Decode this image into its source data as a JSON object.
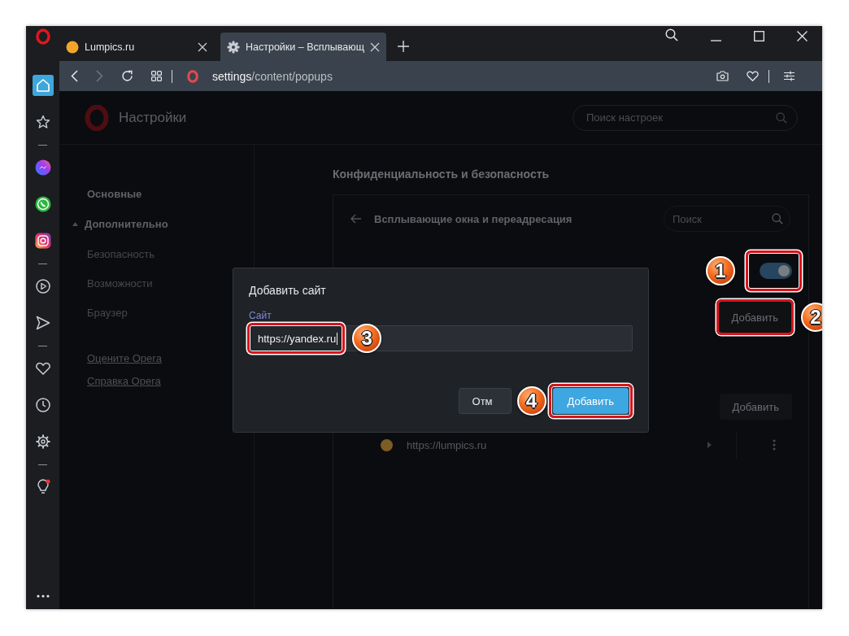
{
  "browser": {
    "tabs": [
      {
        "title": "Lumpics.ru",
        "kind": "site",
        "selected": false
      },
      {
        "title": "Настройки – Всплывающ",
        "kind": "settings",
        "selected": true
      }
    ],
    "address": {
      "host": "settings",
      "path": "/content/popups"
    }
  },
  "sidebar": {
    "groups": [
      [
        {
          "kind": "home",
          "selected": true
        },
        {
          "kind": "star",
          "selected": false
        }
      ],
      [
        {
          "kind": "messenger",
          "selected": false
        },
        {
          "kind": "whatsapp",
          "selected": false
        },
        {
          "kind": "instagram",
          "selected": false
        }
      ],
      [
        {
          "kind": "player",
          "selected": false
        },
        {
          "kind": "send",
          "selected": false
        }
      ],
      [
        {
          "kind": "heart",
          "selected": false
        },
        {
          "kind": "clock",
          "selected": false
        },
        {
          "kind": "gear",
          "selected": false
        }
      ],
      [
        {
          "kind": "bulb",
          "selected": false
        }
      ]
    ]
  },
  "settings": {
    "title": "Настройки",
    "search_placeholder": "Поиск настроек",
    "nav": {
      "main": "Основные",
      "advanced": {
        "label": "Дополнительно",
        "expanded": true,
        "children": [
          "Безопасность",
          "Возможности",
          "Браузер"
        ]
      },
      "links": [
        "Оцените Opera",
        "Справка Opera"
      ]
    },
    "section_title": "Конфиденциальность и безопасность",
    "panel": {
      "title": "Всплывающие окна и переадресация",
      "search_placeholder": "Поиск",
      "toggle": {
        "on": true,
        "callout": "1"
      },
      "add_buttons": [
        {
          "label": "Добавить",
          "callout": "2"
        },
        {
          "label": "Добавить"
        }
      ],
      "sites": [
        {
          "url": "https://lumpics.ru",
          "color": "#7d5c26"
        }
      ]
    }
  },
  "dialog": {
    "title": "Добавить сайт",
    "field_label": "Сайт",
    "value": "https://yandex.ru",
    "value_callout": "3",
    "buttons": [
      {
        "label": "Отм",
        "kind": "secondary"
      },
      {
        "label": "Добавить",
        "kind": "primary",
        "callout": "4"
      }
    ]
  }
}
